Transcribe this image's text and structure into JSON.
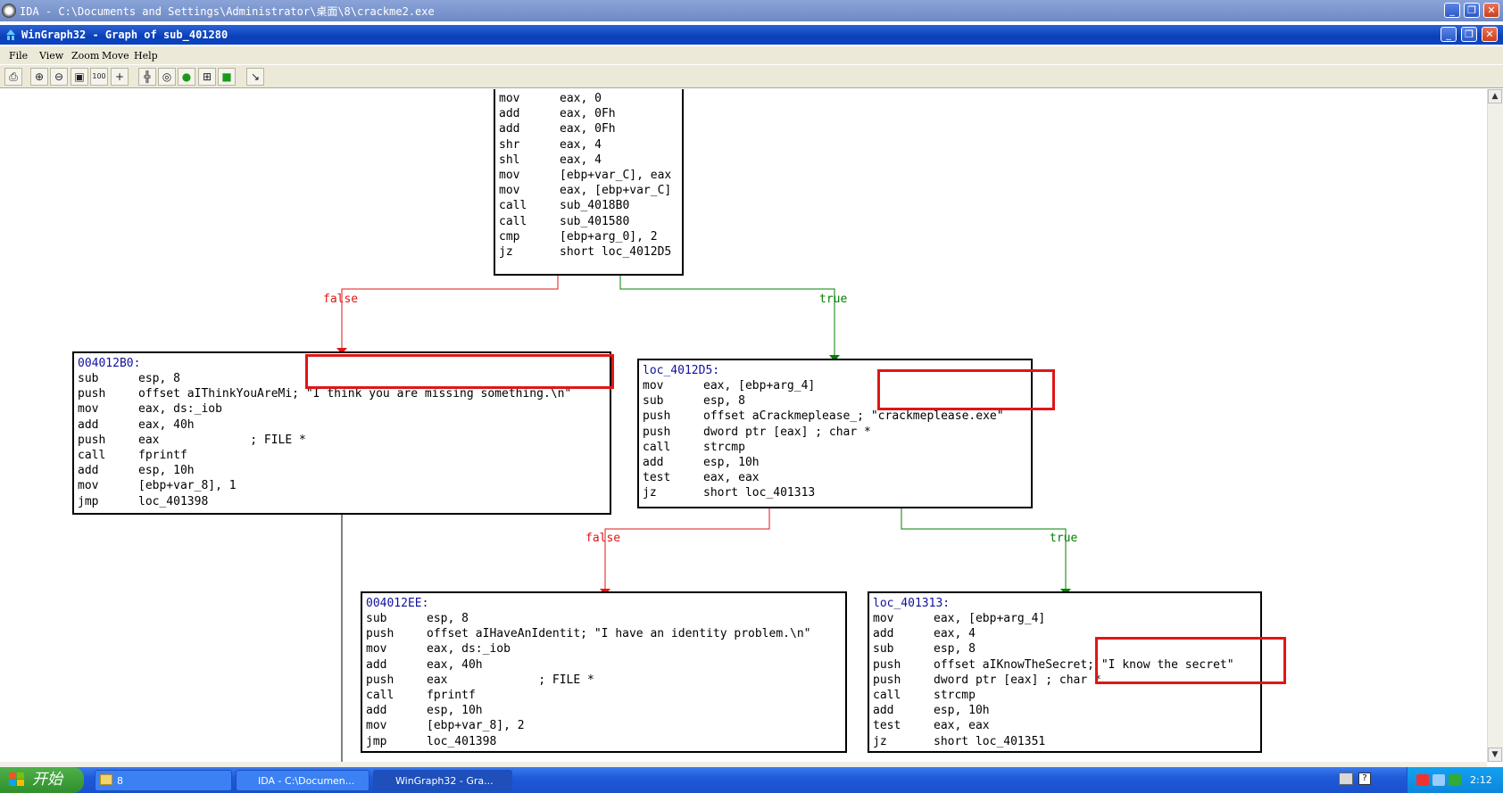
{
  "ida_window": {
    "title": "IDA - C:\\Documents and Settings\\Administrator\\桌面\\8\\crackme2.exe"
  },
  "wingraph": {
    "title": "WinGraph32 - Graph of sub_401280"
  },
  "window_buttons": {
    "minimize": "_",
    "restore": "❐",
    "close": "✕"
  },
  "menu": [
    "File",
    "View",
    "Zoom",
    "Move",
    "Help"
  ],
  "toolbar_icons": [
    "print-icon",
    "zoom-in-icon",
    "zoom-out-icon",
    "fit-icon",
    "zoom-100-icon",
    "center-icon",
    "layout-icon",
    "circle-icon",
    "green-arrow-icon",
    "overview-icon",
    "navigate-icon",
    "cursor-icon"
  ],
  "nodes": {
    "top": {
      "label": "",
      "lines": [
        [
          "mov",
          "eax, 0"
        ],
        [
          "add",
          "eax, 0Fh"
        ],
        [
          "add",
          "eax, 0Fh"
        ],
        [
          "shr",
          "eax, 4"
        ],
        [
          "shl",
          "eax, 4"
        ],
        [
          "mov",
          "[ebp+var_C], eax"
        ],
        [
          "mov",
          "eax, [ebp+var_C]"
        ],
        [
          "call",
          "sub_4018B0"
        ],
        [
          "call",
          "sub_401580"
        ],
        [
          "cmp",
          "[ebp+arg_0], 2"
        ],
        [
          "jz",
          "short loc_4012D5"
        ]
      ]
    },
    "n4012B0": {
      "label": "004012B0:",
      "lines": [
        [
          "sub",
          "esp, 8"
        ],
        [
          "push",
          "offset aIThinkYouAreMi; \"I think you are missing something.\\n\""
        ],
        [
          "mov",
          "eax, ds:_iob"
        ],
        [
          "add",
          "eax, 40h"
        ],
        [
          "push",
          "eax             ; FILE *"
        ],
        [
          "call",
          "fprintf"
        ],
        [
          "add",
          "esp, 10h"
        ],
        [
          "mov",
          "[ebp+var_8], 1"
        ],
        [
          "jmp",
          "loc_401398"
        ]
      ]
    },
    "loc4012D5": {
      "label": "loc_4012D5:",
      "lines": [
        [
          "mov",
          "eax, [ebp+arg_4]"
        ],
        [
          "sub",
          "esp, 8"
        ],
        [
          "push",
          "offset aCrackmeplease_; \"crackmeplease.exe\""
        ],
        [
          "push",
          "dword ptr [eax] ; char *"
        ],
        [
          "call",
          "strcmp"
        ],
        [
          "add",
          "esp, 10h"
        ],
        [
          "test",
          "eax, eax"
        ],
        [
          "jz",
          "short loc_401313"
        ]
      ]
    },
    "n4012EE": {
      "label": "004012EE:",
      "lines": [
        [
          "sub",
          "esp, 8"
        ],
        [
          "push",
          "offset aIHaveAnIdentit; \"I have an identity problem.\\n\""
        ],
        [
          "mov",
          "eax, ds:_iob"
        ],
        [
          "add",
          "eax, 40h"
        ],
        [
          "push",
          "eax             ; FILE *"
        ],
        [
          "call",
          "fprintf"
        ],
        [
          "add",
          "esp, 10h"
        ],
        [
          "mov",
          "[ebp+var_8], 2"
        ],
        [
          "jmp",
          "loc_401398"
        ]
      ]
    },
    "loc401313": {
      "label": "loc_401313:",
      "lines": [
        [
          "mov",
          "eax, [ebp+arg_4]"
        ],
        [
          "add",
          "eax, 4"
        ],
        [
          "sub",
          "esp, 8"
        ],
        [
          "push",
          "offset aIKnowTheSecret; \"I know the secret\""
        ],
        [
          "push",
          "dword ptr [eax] ; char *"
        ],
        [
          "call",
          "strcmp"
        ],
        [
          "add",
          "esp, 10h"
        ],
        [
          "test",
          "eax, eax"
        ],
        [
          "jz",
          "short loc_401351"
        ]
      ]
    }
  },
  "edges": {
    "false_label": "false",
    "true_label": "true"
  },
  "taskbar": {
    "start": "开始",
    "tasks": [
      "8",
      "IDA - C:\\Documen...",
      "WinGraph32 - Gra..."
    ],
    "clock": "2:12"
  },
  "colors": {
    "false_edge": "#e01616",
    "true_edge": "#008000",
    "highlight": "#e01616"
  }
}
